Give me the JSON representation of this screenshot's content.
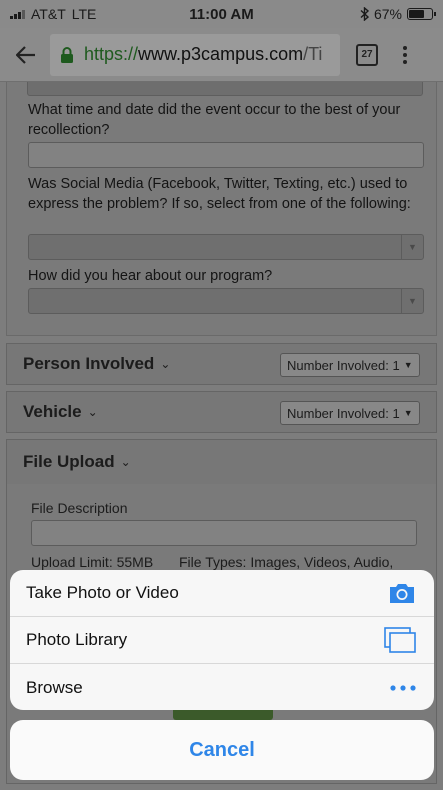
{
  "status_bar": {
    "carrier": "AT&T",
    "network": "LTE",
    "time": "11:00 AM",
    "battery": "67%",
    "battery_level": 0.67
  },
  "browser": {
    "url_scheme": "https://",
    "url_host": "www.p3campus.com",
    "url_path": "/Ti",
    "tab_count": "27"
  },
  "form": {
    "q_datetime": "What time and date did the event occur to the best of your recollection?",
    "q_social_media": "Was Social Media (Facebook, Twitter, Texting, etc.) used to express the problem? If so, select from one of the following:",
    "q_hear_about": "How did you hear about our program?"
  },
  "sections": [
    {
      "title": "Person Involved",
      "count_label": "Number Involved: 1"
    },
    {
      "title": "Vehicle",
      "count_label": "Number Involved: 1"
    },
    {
      "title": "File Upload"
    }
  ],
  "file_upload": {
    "description_label": "File Description",
    "limit": "Upload Limit: 55MB",
    "types": "File Types: Images, Videos, Audio,"
  },
  "action_sheet": {
    "items": [
      {
        "label": "Take Photo or Video",
        "icon": "camera-icon"
      },
      {
        "label": "Photo Library",
        "icon": "photo-library-icon"
      },
      {
        "label": "Browse",
        "icon": "more-icon"
      }
    ],
    "cancel": "Cancel"
  },
  "colors": {
    "accent": "#2f86e8",
    "secure_green": "#1e5a1e"
  }
}
